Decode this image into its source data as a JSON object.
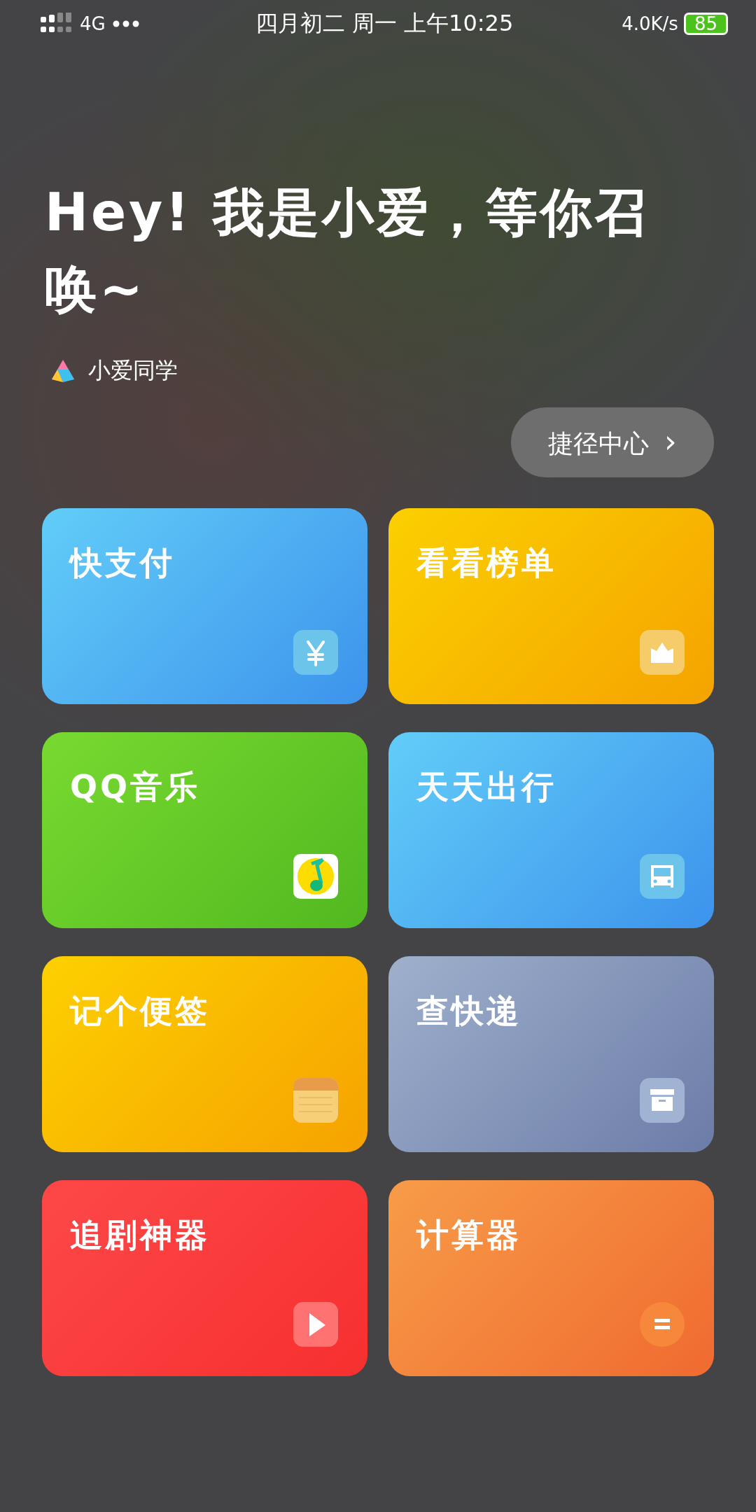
{
  "status_bar": {
    "network": "4G",
    "date_time": "四月初二 周一 上午10:25",
    "speed": "4.0K/s",
    "battery": "85"
  },
  "greeting": "Hey! 我是小爱，等你召唤~",
  "brand": {
    "name": "小爱同学"
  },
  "shortcut_button": {
    "label": "捷径中心",
    "chevron": "›"
  },
  "cards": [
    {
      "title": "快支付",
      "kind": "payment"
    },
    {
      "title": "看看榜单",
      "kind": "ranking"
    },
    {
      "title": "QQ音乐",
      "kind": "music"
    },
    {
      "title": "天天出行",
      "kind": "bus"
    },
    {
      "title": "记个便签",
      "kind": "note"
    },
    {
      "title": "查快递",
      "kind": "parcel"
    },
    {
      "title": "追剧神器",
      "kind": "video"
    },
    {
      "title": "计算器",
      "kind": "calculator"
    }
  ]
}
